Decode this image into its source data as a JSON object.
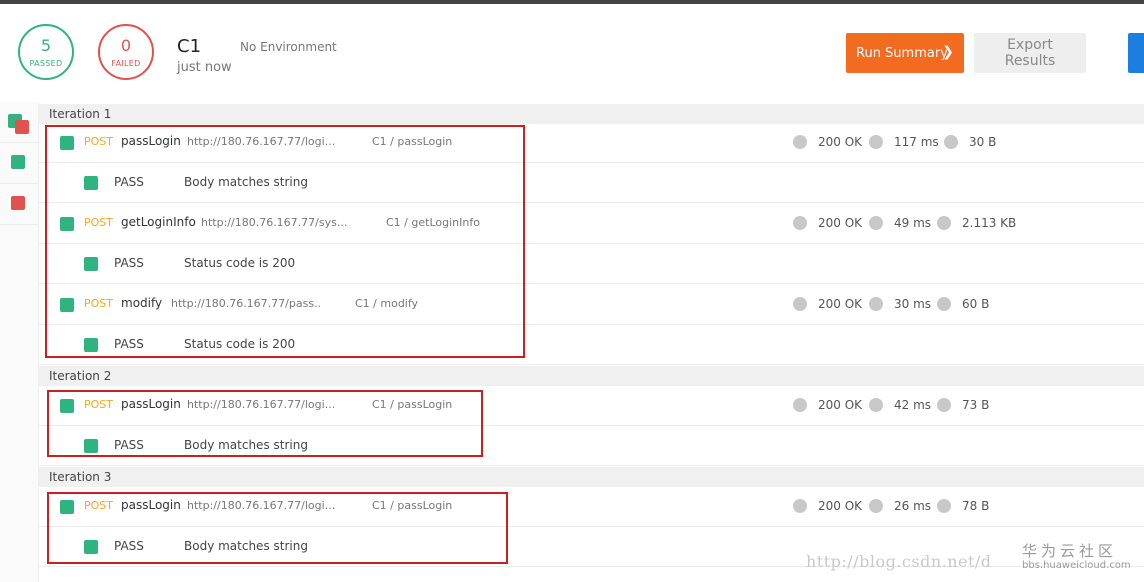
{
  "summary": {
    "passed": {
      "count": "5",
      "label": "PASSED"
    },
    "failed": {
      "count": "0",
      "label": "FAILED"
    },
    "collection": "C1",
    "time": "just now",
    "environment": "No Environment"
  },
  "actions": {
    "run_summary": "Run Summary",
    "export": "Export Results"
  },
  "colors": {
    "pass": "#2fb380",
    "fail": "#e0524f",
    "accent": "#f26b21",
    "method": "#f5a623",
    "highlight_box": "#cc1f1f"
  },
  "iterations": [
    {
      "label": "Iteration 1",
      "requests": [
        {
          "method": "POST",
          "name": "passLogin",
          "url": "http://180.76.167.77/logi...",
          "path": "C1 / passLogin",
          "status": "200 OK",
          "time": "117 ms",
          "size": "30 B",
          "test": {
            "result": "PASS",
            "name": "Body matches string"
          }
        },
        {
          "method": "POST",
          "name": "getLoginInfo",
          "url": "http://180.76.167.77/sys...",
          "path": "C1 / getLoginInfo",
          "status": "200 OK",
          "time": "49 ms",
          "size": "2.113 KB",
          "test": {
            "result": "PASS",
            "name": "Status code is 200"
          }
        },
        {
          "method": "POST",
          "name": "modify",
          "url": "http://180.76.167.77/pass..",
          "path": "C1 / modify",
          "status": "200 OK",
          "time": "30 ms",
          "size": "60 B",
          "test": {
            "result": "PASS",
            "name": "Status code is 200"
          }
        }
      ]
    },
    {
      "label": "Iteration 2",
      "requests": [
        {
          "method": "POST",
          "name": "passLogin",
          "url": "http://180.76.167.77/logi...",
          "path": "C1 / passLogin",
          "status": "200 OK",
          "time": "42 ms",
          "size": "73 B",
          "test": {
            "result": "PASS",
            "name": "Body matches string"
          }
        }
      ]
    },
    {
      "label": "Iteration 3",
      "requests": [
        {
          "method": "POST",
          "name": "passLogin",
          "url": "http://180.76.167.77/logi...",
          "path": "C1 / passLogin",
          "status": "200 OK",
          "time": "26 ms",
          "size": "78 B",
          "test": {
            "result": "PASS",
            "name": "Body matches string"
          }
        }
      ]
    }
  ],
  "watermark": {
    "url": "http://blog.csdn.net/d",
    "brand": "华为云社区",
    "brand_url": "bbs.huaweicloud.com"
  }
}
